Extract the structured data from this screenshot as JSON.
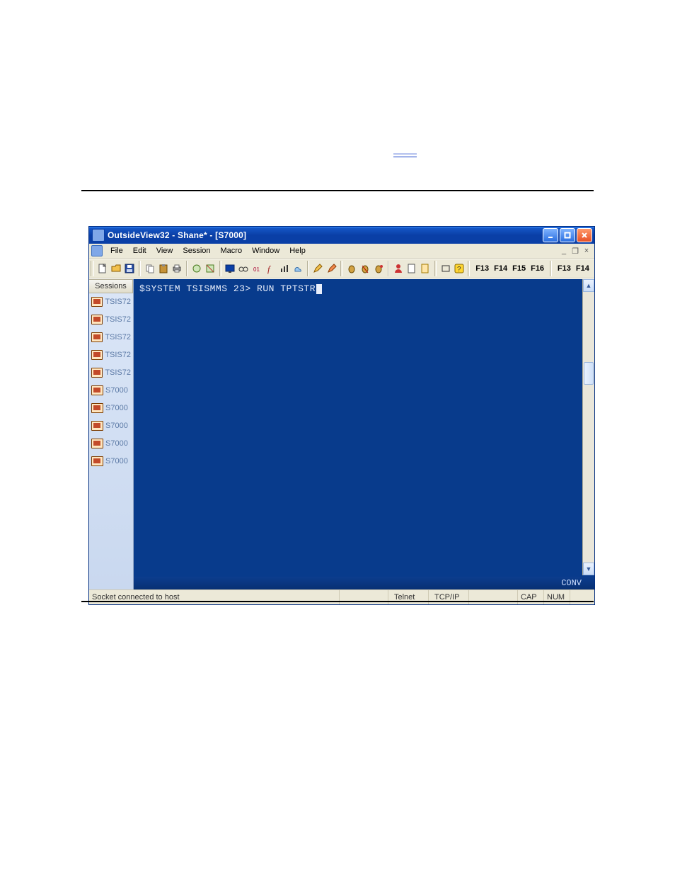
{
  "link": {
    "text": "———"
  },
  "window": {
    "title": "OutsideView32 - Shane* - [S7000]",
    "winbuttons": {
      "min": "_",
      "max": "❐",
      "close": "×"
    }
  },
  "menu": {
    "items": [
      "File",
      "Edit",
      "View",
      "Session",
      "Macro",
      "Window",
      "Help"
    ],
    "mdi": {
      "min": "_",
      "restore": "❐",
      "close": "×"
    }
  },
  "toolbar": {
    "fkeys_a": [
      "F13",
      "F14",
      "F15",
      "F16"
    ],
    "fkeys_b": [
      "F13",
      "F14"
    ],
    "icons": [
      "new-icon",
      "open-icon",
      "save-icon",
      "copy-icon",
      "paste-icon",
      "print-icon",
      "a-icon",
      "b-icon",
      "screen-icon",
      "glasses-icon",
      "binary-icon",
      "function-icon",
      "chart-icon",
      "weather-icon",
      "pencil1-icon",
      "pencil2-icon",
      "bug1-icon",
      "bug2-icon",
      "bug3-icon",
      "person-icon",
      "doc-icon",
      "page-icon",
      "box-icon",
      "help-icon"
    ]
  },
  "sidebar": {
    "header": "Sessions",
    "items": [
      {
        "label": "TSIS72"
      },
      {
        "label": "TSIS72"
      },
      {
        "label": "TSIS72"
      },
      {
        "label": "TSIS72"
      },
      {
        "label": "TSIS72"
      },
      {
        "label": "S7000"
      },
      {
        "label": "S7000"
      },
      {
        "label": "S7000"
      },
      {
        "label": "S7000"
      },
      {
        "label": "S7000"
      }
    ]
  },
  "terminal": {
    "line": "$SYSTEM TSISMMS 23> RUN TPTSTR",
    "mode": "CONV"
  },
  "status": {
    "left": "Socket connected to host",
    "cells": [
      "",
      "Telnet",
      "TCP/IP",
      "",
      "CAP",
      "NUM",
      ""
    ]
  }
}
